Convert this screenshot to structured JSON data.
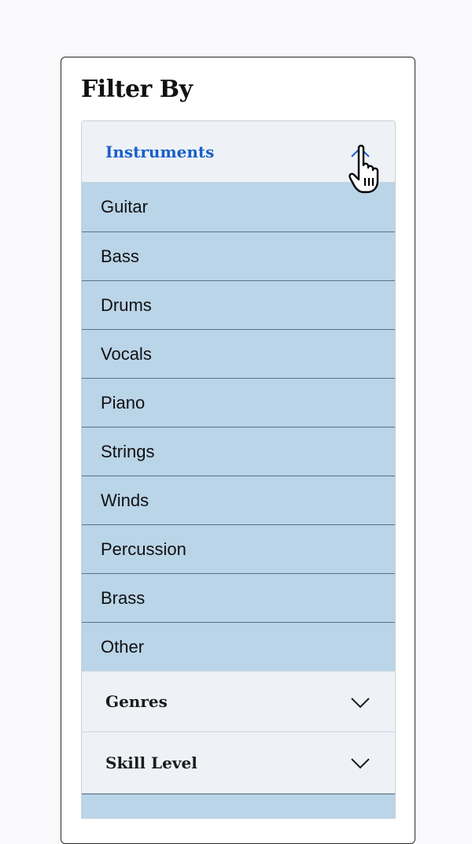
{
  "filter_panel": {
    "title": "Filter By",
    "sections": [
      {
        "label": "Instruments",
        "expanded": true,
        "icon": "chevron-up-icon",
        "options": [
          "Guitar",
          "Bass",
          "Drums",
          "Vocals",
          "Piano",
          "Strings",
          "Winds",
          "Percussion",
          "Brass",
          "Other"
        ]
      },
      {
        "label": "Genres",
        "expanded": false,
        "icon": "chevron-down-icon"
      },
      {
        "label": "Skill Level",
        "expanded": false,
        "icon": "chevron-down-icon"
      }
    ]
  },
  "colors": {
    "active_header_text": "#1a5fc9",
    "option_background": "#bad4e8",
    "header_background": "#eef2f7",
    "option_divider": "#5d7284"
  },
  "cursor": {
    "icon": "hand-pointer-cursor-icon"
  }
}
